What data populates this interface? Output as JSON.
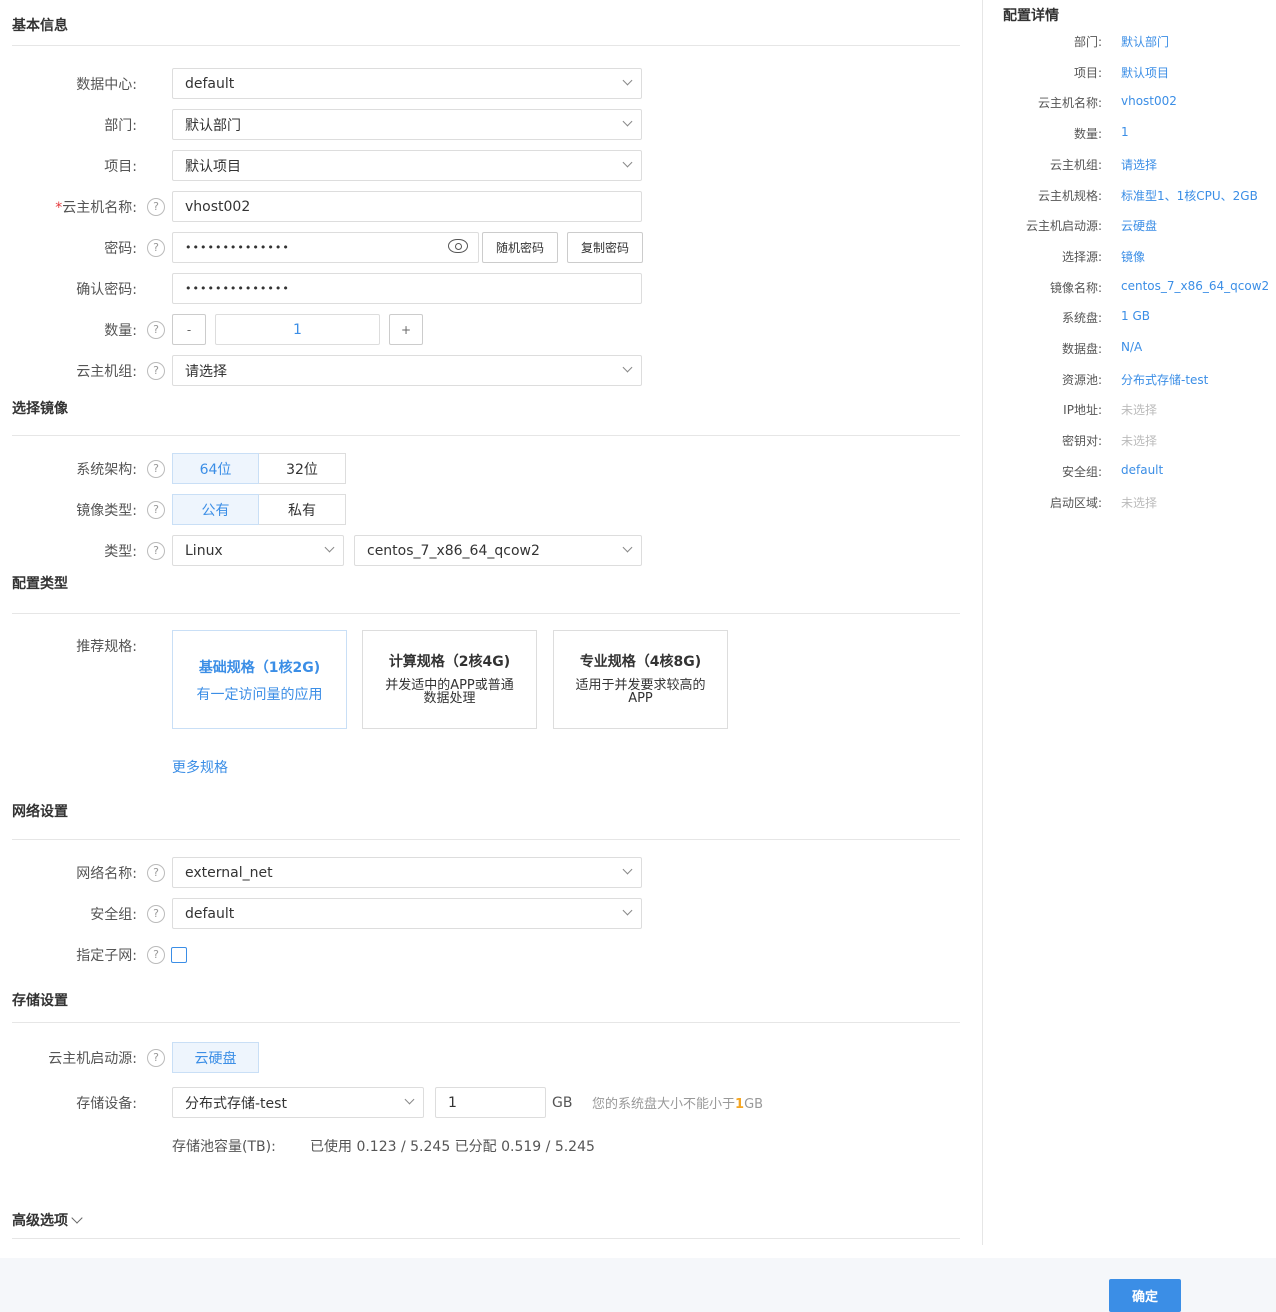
{
  "sections": {
    "basic": "基本信息",
    "image": "选择镜像",
    "config": "配置类型",
    "network": "网络设置",
    "storage": "存储设置",
    "advanced": "高级选项"
  },
  "basic": {
    "datacenter_label": "数据中心:",
    "datacenter_value": "default",
    "dept_label": "部门:",
    "dept_value": "默认部门",
    "project_label": "项目:",
    "project_value": "默认项目",
    "name_required": "*",
    "name_label": "云主机名称:",
    "name_value": "vhost002",
    "password_label": "密码:",
    "password_value": "••••••••••••••",
    "random_password": "随机密码",
    "copy_password": "复制密码",
    "confirm_label": "确认密码:",
    "confirm_value": "••••••••••••••",
    "count_label": "数量:",
    "count_minus": "-",
    "count_value": "1",
    "count_plus": "+",
    "group_label": "云主机组:",
    "group_value": "请选择",
    "help": "?"
  },
  "image": {
    "arch_label": "系统架构:",
    "arch_options": [
      "64位",
      "32位"
    ],
    "type_label": "镜像类型:",
    "type_options": [
      "公有",
      "私有"
    ],
    "os_label": "类型:",
    "os_value": "Linux",
    "image_value": "centos_7_x86_64_qcow2"
  },
  "config": {
    "recommend_label": "推荐规格:",
    "cards": [
      {
        "title": "基础规格（1核2G)",
        "desc": "有一定访问量的应用"
      },
      {
        "title": "计算规格（2核4G)",
        "desc": "并发适中的APP或普通数据处理"
      },
      {
        "title": "专业规格（4核8G)",
        "desc": "适用于并发要求较高的APP"
      }
    ],
    "more": "更多规格"
  },
  "network": {
    "net_label": "网络名称:",
    "net_value": "external_net",
    "sg_label": "安全组:",
    "sg_value": "default",
    "subnet_label": "指定子网:"
  },
  "storage": {
    "boot_label": "云主机启动源:",
    "boot_value": "云硬盘",
    "device_label": "存储设备:",
    "device_value": "分布式存储-test",
    "size_value": "1",
    "unit": "GB",
    "hint_pre": "您的系统盘大小不能小于",
    "hint_num": "1",
    "hint_post": "GB",
    "pool_label": "存储池容量(TB):",
    "pool_value": "已使用 0.123 / 5.245 已分配 0.519 / 5.245"
  },
  "side": {
    "title": "配置详情",
    "items": [
      {
        "k": "部门:",
        "v": "默认部门"
      },
      {
        "k": "项目:",
        "v": "默认项目"
      },
      {
        "k": "云主机名称:",
        "v": "vhost002"
      },
      {
        "k": "数量:",
        "v": "1"
      },
      {
        "k": "云主机组:",
        "v": "请选择"
      },
      {
        "k": "云主机规格:",
        "v": "标准型1、1核CPU、2GB"
      },
      {
        "k": "云主机启动源:",
        "v": "云硬盘"
      },
      {
        "k": "选择源:",
        "v": "镜像"
      },
      {
        "k": "镜像名称:",
        "v": "centos_7_x86_64_qcow2"
      },
      {
        "k": "系统盘:",
        "v": "1 GB"
      },
      {
        "k": "数据盘:",
        "v": "N/A"
      },
      {
        "k": "资源池:",
        "v": "分布式存储-test"
      },
      {
        "k": "IP地址:",
        "v": "未选择"
      },
      {
        "k": "密钥对:",
        "v": "未选择"
      },
      {
        "k": "安全组:",
        "v": "default"
      },
      {
        "k": "启动区域:",
        "v": "未选择"
      }
    ]
  },
  "footer": {
    "ok": "确定"
  }
}
